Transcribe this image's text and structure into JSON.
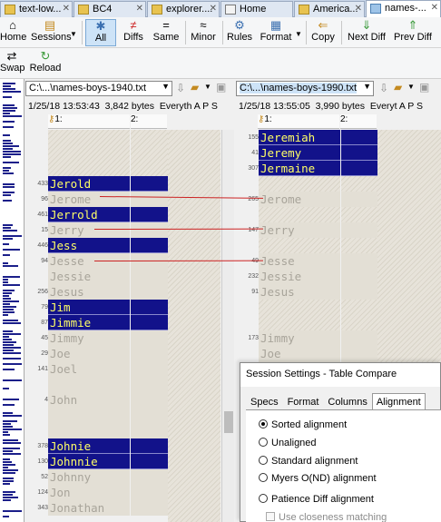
{
  "tabs": [
    {
      "label": "text-low..."
    },
    {
      "label": "BC4"
    },
    {
      "label": "explorer...."
    },
    {
      "label": "Home"
    },
    {
      "label": "America..."
    },
    {
      "label": "names-..."
    }
  ],
  "toolbar": {
    "home": "Home",
    "sessions": "Sessions",
    "all": "All",
    "diffs": "Diffs",
    "same": "Same",
    "minor": "Minor",
    "rules": "Rules",
    "format": "Format",
    "copy": "Copy",
    "next_diff": "Next Diff",
    "prev_diff": "Prev Diff",
    "swap": "Swap",
    "reload": "Reload"
  },
  "left": {
    "path": "C:\\...\\names-boys-1940.txt",
    "timestamp": "1/25/18 13:53:43",
    "size": "3,842 bytes",
    "encoding": "Everyth  A  P  S",
    "col1": "1:",
    "col2": "2:",
    "rows": [
      {
        "num": "",
        "text": "",
        "kind": "hatch"
      },
      {
        "num": "",
        "text": "",
        "kind": "hatch"
      },
      {
        "num": "",
        "text": "",
        "kind": "hatch"
      },
      {
        "num": "433",
        "text": "Jerold",
        "kind": "diff"
      },
      {
        "num": "96",
        "text": "Jerome",
        "kind": "gone"
      },
      {
        "num": "461",
        "text": "Jerrold",
        "kind": "diff"
      },
      {
        "num": "15",
        "text": "Jerry",
        "kind": "gone"
      },
      {
        "num": "446",
        "text": "Jess",
        "kind": "diff"
      },
      {
        "num": "94",
        "text": "Jesse",
        "kind": "gone"
      },
      {
        "num": "",
        "text": "Jessie",
        "kind": "gone"
      },
      {
        "num": "256",
        "text": "Jesus",
        "kind": "gone"
      },
      {
        "num": "79",
        "text": "Jim",
        "kind": "diff"
      },
      {
        "num": "87",
        "text": "Jimmie",
        "kind": "diff"
      },
      {
        "num": "45",
        "text": "Jimmy",
        "kind": "gone"
      },
      {
        "num": "29",
        "text": "Joe",
        "kind": "gone"
      },
      {
        "num": "141",
        "text": "Joel",
        "kind": "gone"
      },
      {
        "num": "",
        "text": "",
        "kind": "gone"
      },
      {
        "num": "4",
        "text": "John",
        "kind": "gone"
      },
      {
        "num": "",
        "text": "",
        "kind": "gone"
      },
      {
        "num": "",
        "text": "",
        "kind": "gone"
      },
      {
        "num": "378",
        "text": "Johnie",
        "kind": "diff"
      },
      {
        "num": "130",
        "text": "Johnnie",
        "kind": "diff"
      },
      {
        "num": "52",
        "text": "Johnny",
        "kind": "gone"
      },
      {
        "num": "124",
        "text": "Jon",
        "kind": "gone"
      },
      {
        "num": "343",
        "text": "Jonathan",
        "kind": "gone"
      }
    ]
  },
  "right": {
    "path": "C:\\...\\names-boys-1990.txt",
    "timestamp": "1/25/18 13:55:05",
    "size": "3,990 bytes",
    "encoding": "Everyt  A  P  S",
    "col1": "1:",
    "col2": "2:",
    "rows": [
      {
        "num": "155",
        "text": "Jeremiah",
        "kind": "diff"
      },
      {
        "num": "41",
        "text": "Jeremy",
        "kind": "diff"
      },
      {
        "num": "307",
        "text": "Jermaine",
        "kind": "diff"
      },
      {
        "num": "",
        "text": "",
        "kind": "hatch"
      },
      {
        "num": "265",
        "text": "Jerome",
        "kind": "gone"
      },
      {
        "num": "",
        "text": "",
        "kind": "hatch"
      },
      {
        "num": "147",
        "text": "Jerry",
        "kind": "gone"
      },
      {
        "num": "",
        "text": "",
        "kind": "hatch"
      },
      {
        "num": "49",
        "text": "Jesse",
        "kind": "gone"
      },
      {
        "num": "232",
        "text": "Jessie",
        "kind": "gone"
      },
      {
        "num": "91",
        "text": "Jesus",
        "kind": "gone"
      },
      {
        "num": "",
        "text": "",
        "kind": "hatch"
      },
      {
        "num": "",
        "text": "",
        "kind": "hatch"
      },
      {
        "num": "173",
        "text": "Jimmy",
        "kind": "gone"
      },
      {
        "num": "",
        "text": "Joe",
        "kind": "gone"
      },
      {
        "num": "",
        "text": "Joel",
        "kind": "gone"
      },
      {
        "num": "",
        "text": "",
        "kind": "gone"
      }
    ]
  },
  "dialog": {
    "title": "Session Settings - Table Compare",
    "tabs": [
      "Specs",
      "Format",
      "Columns",
      "Alignment"
    ],
    "options": [
      {
        "label": "Sorted alignment",
        "selected": true
      },
      {
        "label": "Unaligned",
        "selected": false
      },
      {
        "label": "Standard alignment",
        "selected": false
      },
      {
        "label": "Myers O(ND) alignment",
        "selected": false
      },
      {
        "label": "Patience Diff alignment",
        "selected": false
      }
    ],
    "closeness": "Use closeness matching"
  },
  "colors": {
    "diff_bg": "#12128a",
    "diff_text": "#ffff66",
    "link": "#cc2222"
  }
}
